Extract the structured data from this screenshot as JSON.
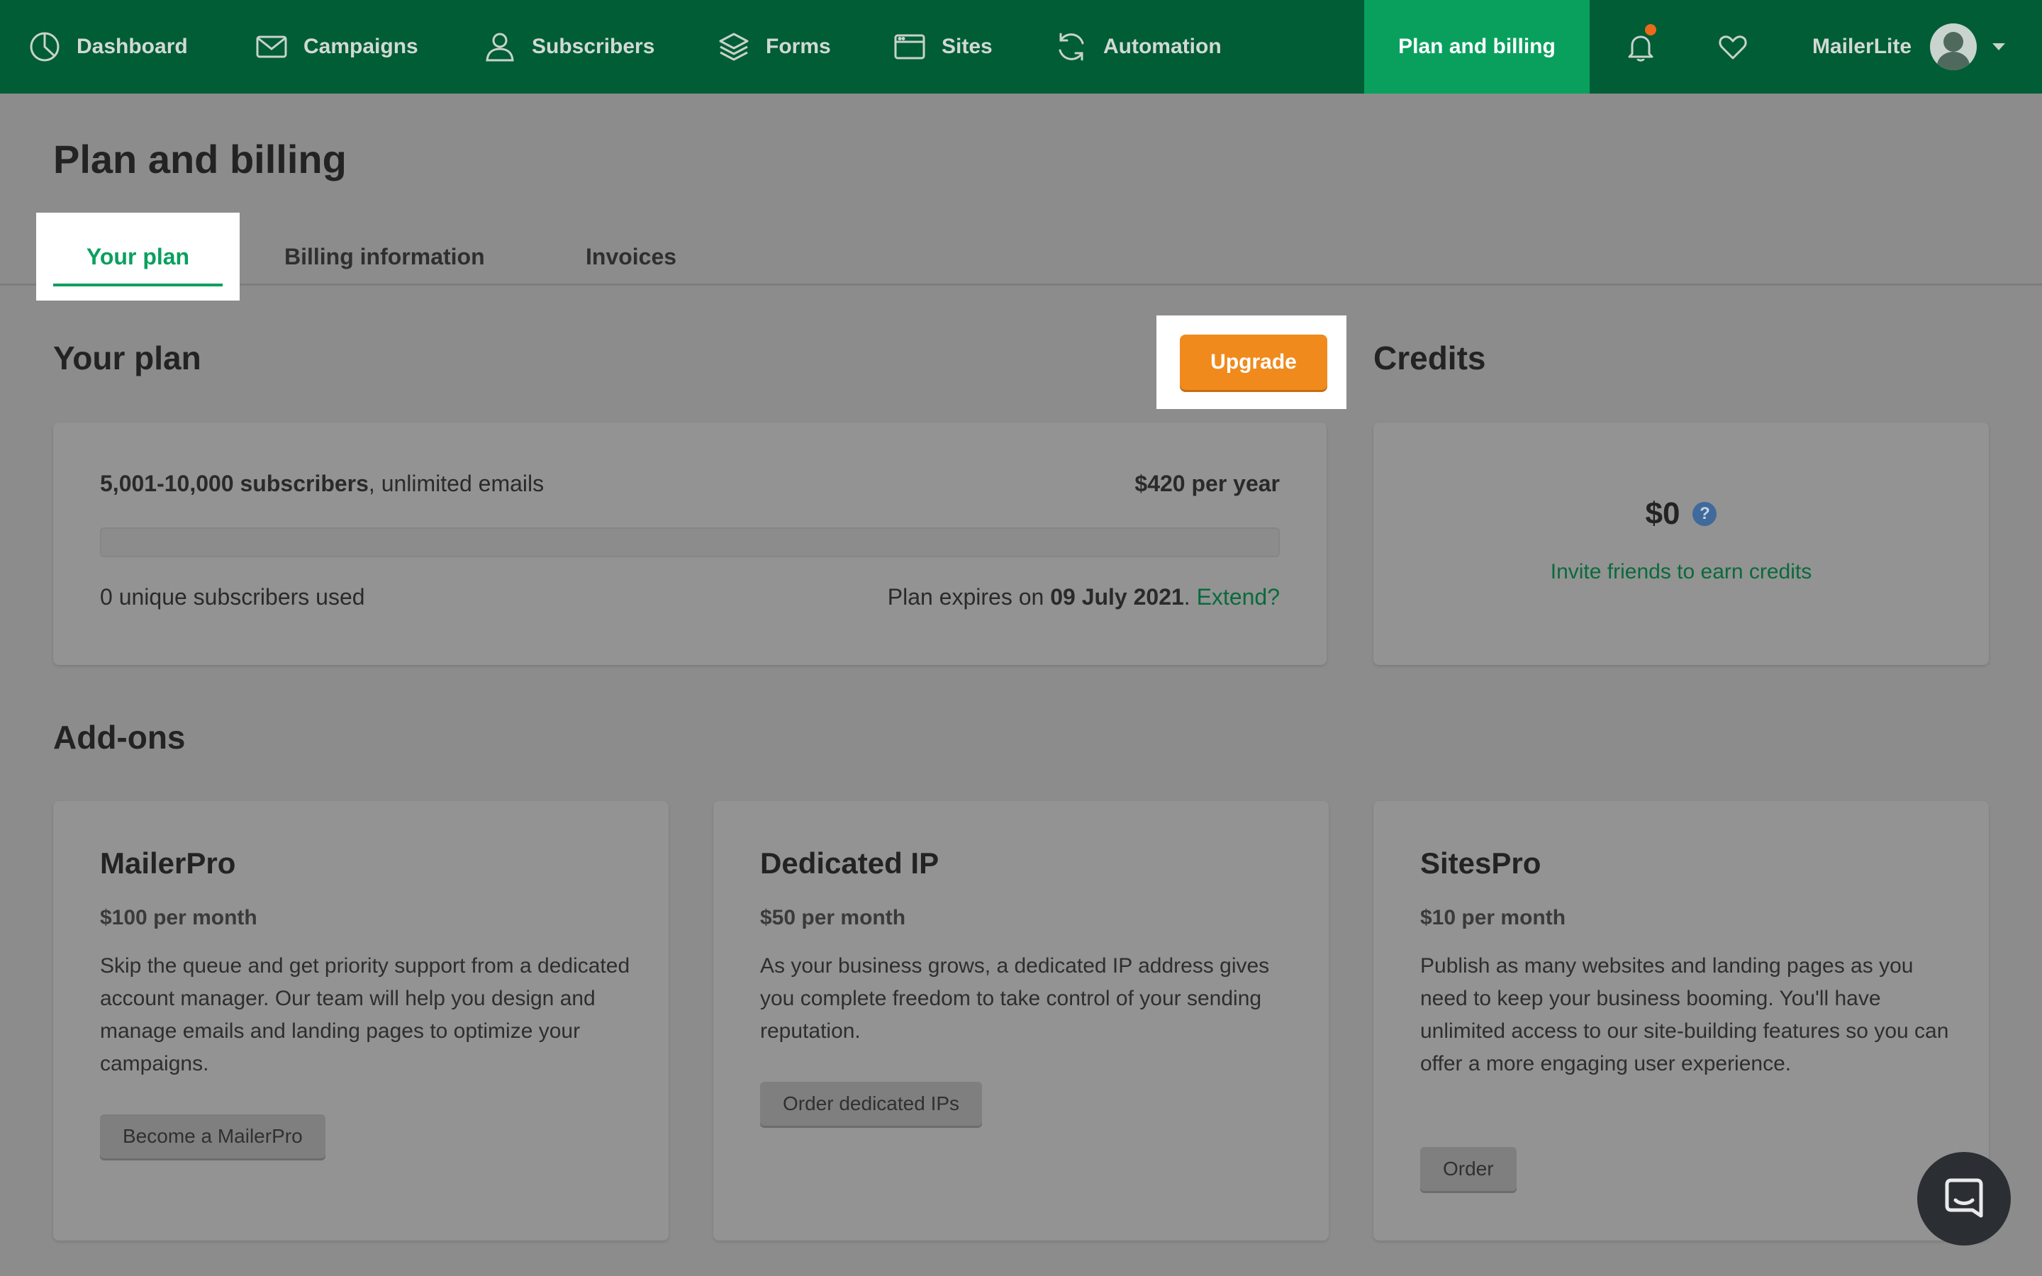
{
  "nav": {
    "items": [
      {
        "label": "Dashboard",
        "icon": "dashboard-icon"
      },
      {
        "label": "Campaigns",
        "icon": "envelope-icon"
      },
      {
        "label": "Subscribers",
        "icon": "user-icon"
      },
      {
        "label": "Forms",
        "icon": "layers-icon"
      },
      {
        "label": "Sites",
        "icon": "browser-window-icon"
      },
      {
        "label": "Automation",
        "icon": "refresh-icon"
      }
    ],
    "active_label": "Plan and billing",
    "account_name": "MailerLite",
    "colors": {
      "bar": "#005d35",
      "active": "#09a05e",
      "notification": "#e96a1a"
    }
  },
  "page": {
    "title": "Plan and billing",
    "tabs": [
      {
        "label": "Your plan",
        "active": true
      },
      {
        "label": "Billing information",
        "active": false
      },
      {
        "label": "Invoices",
        "active": false
      }
    ]
  },
  "plan": {
    "heading": "Your plan",
    "upgrade_label": "Upgrade",
    "subscribers_range": "5,001-10,000 subscribers",
    "emails_text": ", unlimited emails",
    "price": "$420 per year",
    "usage_text": "0 unique subscribers used",
    "usage_fraction": 0,
    "expires_prefix": "Plan expires on ",
    "expires_date": "09 July 2021",
    "expires_suffix": ". ",
    "extend_label": "Extend?"
  },
  "credits": {
    "heading": "Credits",
    "amount": "$0",
    "help_glyph": "?",
    "invite_label": "Invite friends to earn credits"
  },
  "addons": {
    "heading": "Add-ons",
    "items": [
      {
        "title": "MailerPro",
        "price": "$100 per month",
        "description": "Skip the queue and get priority support from a dedicated account manager. Our team will help you design and manage emails and landing pages to optimize your campaigns.",
        "button": "Become a MailerPro"
      },
      {
        "title": "Dedicated IP",
        "price": "$50 per month",
        "description": "As your business grows, a dedicated IP address gives you complete freedom to take control of your sending reputation.",
        "button": "Order dedicated IPs"
      },
      {
        "title": "SitesPro",
        "price": "$10 per month",
        "description": "Publish as many websites and landing pages as you need to keep your business booming. You'll have unlimited access to our site-building features so you can offer a more engaging user experience.",
        "button": "Order"
      }
    ]
  },
  "accent_colors": {
    "brand_green": "#09a05e",
    "upgrade_orange": "#f08a1d",
    "link_green": "#0a6a3b"
  }
}
